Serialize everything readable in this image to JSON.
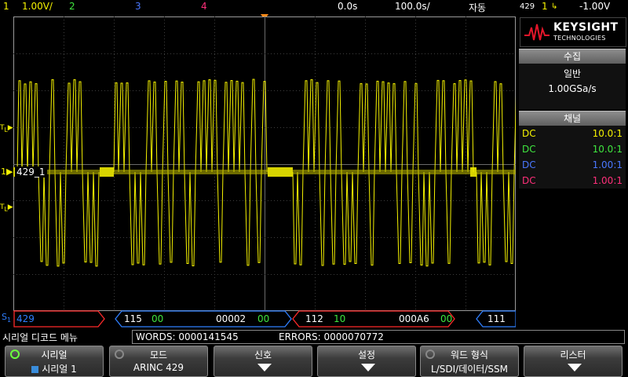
{
  "topbar": {
    "ch1": "1",
    "ch1_scale": "1.00V/",
    "ch2": "2",
    "ch3": "3",
    "ch4": "4",
    "time_offset": "0.0s",
    "time_scale": "100.0s/",
    "trigger_mode": "자동",
    "trigger_source_label": "429",
    "trigger_channel": "1",
    "trigger_level": "-1.00V"
  },
  "colors": {
    "ch1": "#f5f200",
    "ch2": "#3fe63f",
    "ch3": "#4a78ff",
    "ch4": "#ff2f7a",
    "bus": "#2f7fff",
    "bus_error": "#ff2a2a",
    "label_num": "#3fe63f"
  },
  "logo": {
    "brand": "KEYSIGHT",
    "sub": "TECHNOLOGIES"
  },
  "acquisition": {
    "header": "수집",
    "mode": "일반",
    "rate": "1.00GSa/s"
  },
  "channels": {
    "header": "채널",
    "rows": [
      {
        "coupling": "DC",
        "probe": "10.0:1"
      },
      {
        "coupling": "DC",
        "probe": "10.0:1"
      },
      {
        "coupling": "DC",
        "probe": "1.00:1"
      },
      {
        "coupling": "DC",
        "probe": "1.00:1"
      }
    ]
  },
  "markers": {
    "channel_label": "429_1",
    "serial_marker": "S",
    "serial_index": "1"
  },
  "decode": {
    "segments": [
      {
        "label": "429",
        "a": "",
        "b": "",
        "c": ""
      },
      {
        "label": "115",
        "a": "00",
        "b": "00002",
        "c": "00"
      },
      {
        "label": "112",
        "a": "10",
        "b": "000A6",
        "c": "00"
      },
      {
        "label": "111",
        "a": "",
        "b": "",
        "c": ""
      }
    ]
  },
  "status": {
    "menu_title": "시리얼 디코드 메뉴",
    "words": "WORDS: 0000141545",
    "errors": "ERRORS: 0000070772"
  },
  "softkeys": [
    {
      "title": "시리얼",
      "value": "시리얼 1"
    },
    {
      "title": "모드",
      "value": "ARINC 429"
    },
    {
      "title": "신호",
      "value": ""
    },
    {
      "title": "설정",
      "value": ""
    },
    {
      "title": "워드 형식",
      "value": "L/SDI/데이터/SSM"
    },
    {
      "title": "리스터",
      "value": ""
    }
  ]
}
